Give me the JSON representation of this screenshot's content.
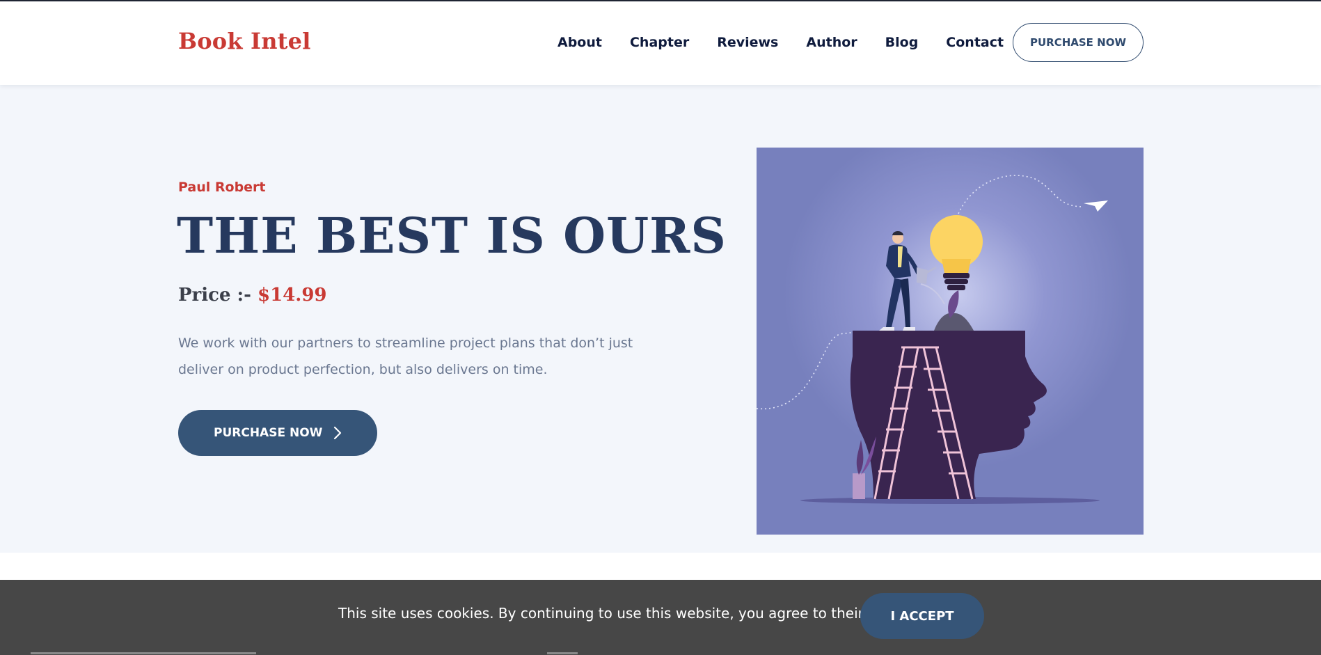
{
  "brand": {
    "name": "Book Intel",
    "color": "#c93a34"
  },
  "nav": {
    "items": [
      "About",
      "Chapter",
      "Reviews",
      "Author",
      "Blog",
      "Contact"
    ],
    "purchase_label": "PURCHASE NOW"
  },
  "hero": {
    "author": "Paul Robert",
    "title": "THE BEST IS OURS",
    "price_label": "Price :- ",
    "price_value": "$14.99",
    "description": "We work with our partners to streamline project plans that don’t just deliver on product perfection, but also delivers on time.",
    "button_label": "PURCHASE NOW",
    "button_icon": "chevron-right-icon",
    "illustration": "head-with-lightbulb-illustration"
  },
  "cookie": {
    "message": "This site uses cookies. By continuing to use this website, you agree to their use.",
    "accept_label": "I ACCEPT"
  },
  "colors": {
    "accent": "#c93a34",
    "primary": "#365578",
    "heading": "#26395e",
    "hero_bg": "#f3f6fb",
    "illustration_bg": "#7780bd",
    "cookie_bg": "#474747"
  }
}
